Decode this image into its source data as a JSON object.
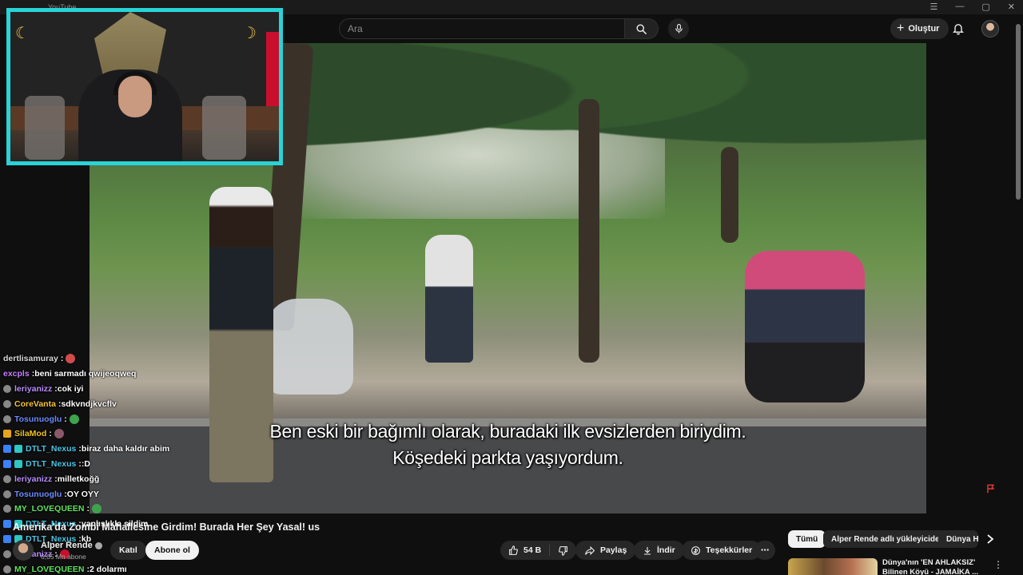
{
  "browser": {
    "tab_title": "YouTube"
  },
  "header": {
    "search_placeholder": "Ara",
    "create_label": "Oluştur"
  },
  "subtitles": {
    "line1": "Ben eski bir bağımlı olarak, buradaki ilk evsizlerden biriydim.",
    "line2": "Köşedeki parkta yaşıyordum."
  },
  "chat": [
    {
      "user": "dertlisamuray",
      "msg": "",
      "color": "#d6d6d6",
      "badge": "none",
      "emote": "#d24b4b"
    },
    {
      "user": "excpls",
      "msg": "beni sarmadı qwijeoqweq",
      "color": "#c67fff",
      "badge": "none",
      "emote": ""
    },
    {
      "user": "leriyanizz",
      "msg": "cok iyi",
      "color": "#b88cff",
      "badge": "round",
      "emote": ""
    },
    {
      "user": "CoreVanta",
      "msg": "sdkvndjkvcflv",
      "color": "#f4c430",
      "badge": "round",
      "emote": ""
    },
    {
      "user": "Tosunuoglu",
      "msg": "",
      "color": "#6b8cff",
      "badge": "round",
      "emote": "#3fa34d"
    },
    {
      "user": "SilaMod",
      "msg": "",
      "color": "#f0c419",
      "badge": "gold",
      "emote": "#8a5a6a"
    },
    {
      "user": "DTLT_Nexus",
      "msg": "biraz daha kaldır abim",
      "color": "#49c6e5",
      "badge": "double",
      "emote": ""
    },
    {
      "user": "DTLT_Nexus",
      "msg": ":D",
      "color": "#49c6e5",
      "badge": "double",
      "emote": ""
    },
    {
      "user": "leriyanizz",
      "msg": "milletkoğğ",
      "color": "#b88cff",
      "badge": "round",
      "emote": ""
    },
    {
      "user": "Tosunuoglu",
      "msg": "OY OYY",
      "color": "#6b8cff",
      "badge": "round",
      "emote": ""
    },
    {
      "user": "MY_LOVEQUEEN",
      "msg": "",
      "color": "#5fe35f",
      "badge": "round",
      "emote": "#3fa34d"
    },
    {
      "user": "DTLT_Nexus",
      "msg": "yanlışlıkla sildim",
      "color": "#49c6e5",
      "badge": "double",
      "emote": ""
    },
    {
      "user": "DTLT_Nexus",
      "msg": "kb",
      "color": "#49c6e5",
      "badge": "double",
      "emote": ""
    },
    {
      "user": "leriyanizz",
      "msg": "",
      "color": "#b88cff",
      "badge": "round",
      "emote": "#c8102e"
    },
    {
      "user": "MY_LOVEQUEEN",
      "msg": "2 dolarmı",
      "color": "#5fe35f",
      "badge": "round",
      "emote": ""
    }
  ],
  "video": {
    "title": "Amerika'da Zombi Mahallesine Girdim! Burada Her Şey Yasal! us",
    "channel_name": "Alper Rende",
    "subscribers": "6,05 Mn abone",
    "join_label": "Katıl",
    "subscribe_label": "Abone ol",
    "likes": "54 B",
    "share_label": "Paylaş",
    "download_label": "İndir",
    "thanks_label": "Teşekkürler",
    "more_label": "⋯"
  },
  "chips": {
    "all": "Tümü",
    "uploader": "Alper Rende adlı yükleyiciden",
    "world": "Dünya H"
  },
  "recommendation": {
    "title": "Dünya'nın 'EN AHLAKSIZ' Bilinen Köyü - JAMAİKA ..."
  }
}
